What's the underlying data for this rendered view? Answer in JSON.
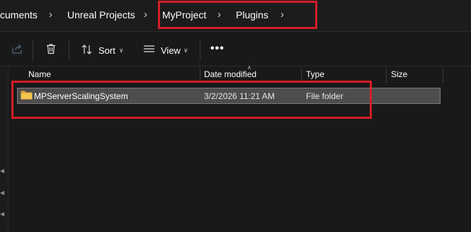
{
  "breadcrumb": {
    "items": [
      "cuments",
      "Unreal Projects",
      "MyProject",
      "Plugins"
    ]
  },
  "toolbar": {
    "share_icon": "share-icon",
    "delete_icon": "trash-icon",
    "sort_label": "Sort",
    "view_label": "View",
    "more_label": "•••"
  },
  "columns": {
    "name": "Name",
    "date": "Date modified",
    "type": "Type",
    "size": "Size"
  },
  "files": [
    {
      "name": "MPServerScalingSystem",
      "date": "3/2/2026 11:21 AM",
      "type": "File folder",
      "size": "",
      "icon": "folder-icon",
      "selected": true
    }
  ],
  "colors": {
    "highlight": "#d21f26",
    "folder": "#f3c44f",
    "background": "#191919",
    "selection": "#4d4d4d"
  }
}
